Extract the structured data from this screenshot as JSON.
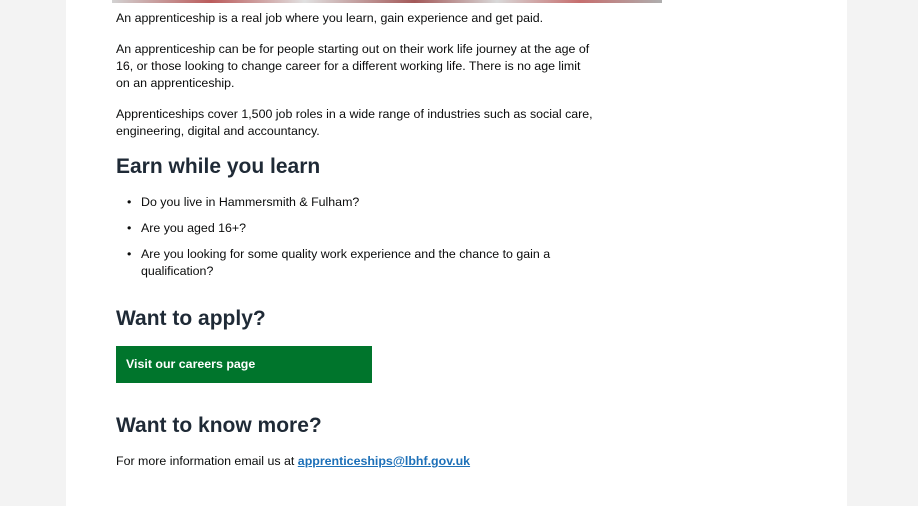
{
  "intro": {
    "p1": "An apprenticeship is a real job where you learn, gain experience and get paid.",
    "p2_line1": "An apprenticeship can be for people starting out on their work life journey at the age of",
    "p2_line2": "16, or those looking to change career for a different working life. There is no age limit",
    "p2_line3": "on an apprenticeship.",
    "p3_line1": "Apprenticeships cover 1,500 job roles in a wide range of industries such as social care,",
    "p3_line2": "engineering, digital and accountancy."
  },
  "earn": {
    "heading": "Earn while you learn",
    "bullets": [
      {
        "line1": "Do you live in Hammersmith & Fulham?",
        "line2": ""
      },
      {
        "line1": "Are you aged 16+?",
        "line2": ""
      },
      {
        "line1": "Are you looking for some quality work experience and the chance to gain a",
        "line2": "qualification?"
      }
    ]
  },
  "apply": {
    "heading": "Want to apply?",
    "button_label": "Visit our careers page",
    "button_color": "#00752c"
  },
  "more": {
    "heading": "Want to know more?",
    "text_prefix": "For more information email us at ",
    "email": "apprenticeships@lbhf.gov.uk",
    "link_color": "#1d70b8"
  }
}
